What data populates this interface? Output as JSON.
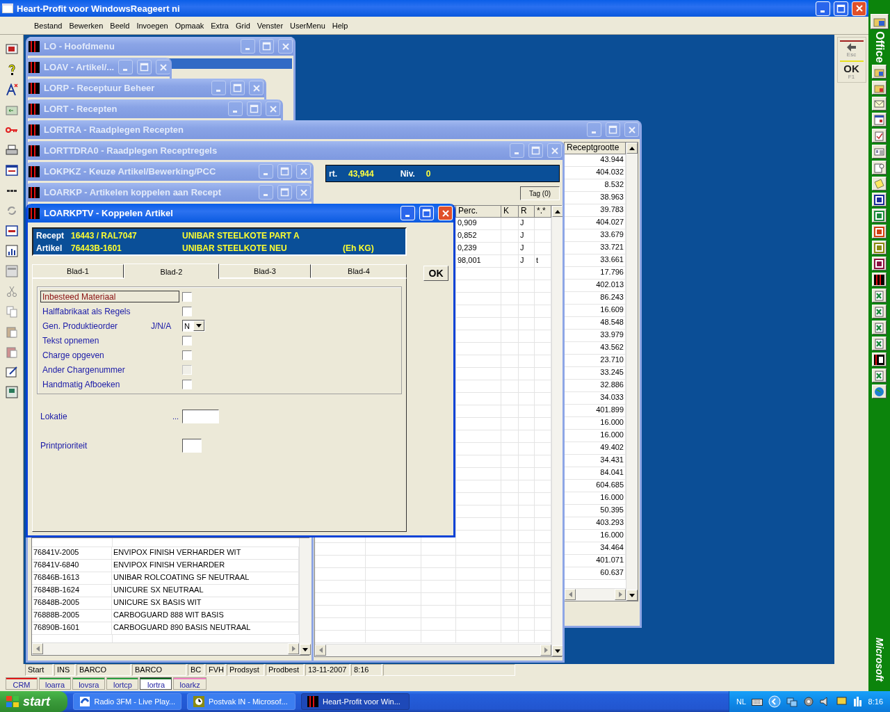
{
  "app": {
    "title": "Heart-Profit voor WindowsReageert ni"
  },
  "menu": [
    "Bestand",
    "Bewerken",
    "Beeld",
    "Invoegen",
    "Opmaak",
    "Extra",
    "Grid",
    "Venster",
    "UserMenu",
    "Help"
  ],
  "windows": [
    {
      "kind": "hoofdmenu",
      "title": "LO - Hoofdmenu",
      "active": false
    },
    {
      "kind": "plain",
      "title": "LOAV - Artikel/...",
      "active": false
    },
    {
      "kind": "plain",
      "title": "LORP - Receptuur Beheer",
      "active": false
    },
    {
      "kind": "plain",
      "title": "LORT - Recepten",
      "active": false
    },
    {
      "kind": "recepten",
      "title": "LORTRA - Raadplegen Recepten",
      "active": false
    },
    {
      "kind": "receptregels",
      "title": "LORTTDRA0 - Raadplegen Receptregels",
      "active": false
    },
    {
      "kind": "artikelen",
      "title": "LOKPKZ - Keuze Artikel/Bewerking/PCC",
      "active": false
    },
    {
      "kind": "plain",
      "title": "LOARKP - Artikelen koppelen aan Recept",
      "active": false
    },
    {
      "kind": "dialog",
      "title": "LOARKPTV - Koppelen Artikel",
      "active": true
    }
  ],
  "recepten": {
    "column": "Receptgrootte",
    "values": [
      "43.944",
      "404.032",
      "8.532",
      "38.963",
      "39.783",
      "404.027",
      "33.679",
      "33.721",
      "33.661",
      "17.796",
      "402.013",
      "86.243",
      "16.609",
      "48.548",
      "33.979",
      "43.562",
      "23.710",
      "33.245",
      "32.886",
      "34.033",
      "401.899",
      "16.000",
      "16.000",
      "49.402",
      "34.431",
      "84.041",
      "604.685",
      "16.000",
      "50.395",
      "403.293",
      "16.000",
      "34.464",
      "401.071",
      "60.637"
    ]
  },
  "receptregels": {
    "header": [
      {
        "label": "rt.",
        "value": "43,944"
      },
      {
        "label": "Niv.",
        "value": "0"
      }
    ],
    "tag_button": "Tag (0)",
    "columns": [
      "Perc.",
      "K",
      "R",
      "*.*"
    ],
    "rows": [
      {
        "perc": "0,909",
        "r": "J"
      },
      {
        "perc": "0,852",
        "r": "J"
      },
      {
        "perc": "0,239",
        "r": "J"
      },
      {
        "perc": "98,001",
        "r": "J",
        "flag": "t"
      }
    ]
  },
  "artikelen": {
    "rows": [
      {
        "code": "76841V-2005",
        "name": "ENVIPOX FINISH VERHARDER WIT"
      },
      {
        "code": "76841V-6840",
        "name": "ENVIPOX FINISH VERHARDER"
      },
      {
        "code": "76846B-1613",
        "name": "UNIBAR ROLCOATING SF NEUTRAAL"
      },
      {
        "code": "76848B-1624",
        "name": "UNICURE SX NEUTRAAL"
      },
      {
        "code": "76848B-2005",
        "name": "UNICURE SX BASIS WIT"
      },
      {
        "code": "76888B-2005",
        "name": "CARBOGUARD 888 WIT BASIS"
      },
      {
        "code": "76890B-1601",
        "name": "CARBOGUARD 890 BASIS NEUTRAAL"
      }
    ]
  },
  "dialog": {
    "info": [
      {
        "label": "Recept",
        "code": "16443 / RAL7047",
        "name": "UNIBAR STEELKOTE PART A"
      },
      {
        "label": "Artikel",
        "code": "76443B-1601",
        "name": "UNIBAR STEELKOTE NEU",
        "unit": "(Eh KG)"
      }
    ],
    "tabs": [
      {
        "label": "Blad-1",
        "selected": false
      },
      {
        "label": "Blad-2",
        "selected": true
      },
      {
        "label": "Blad-3",
        "selected": false
      },
      {
        "label": "Blad-4",
        "selected": false
      }
    ],
    "options": [
      {
        "kind": "checkbox",
        "label": "Inbesteed Materiaal",
        "checked": false,
        "focused": true,
        "disabled": false
      },
      {
        "kind": "checkbox",
        "label": "Halffabrikaat als Regels",
        "checked": false,
        "focused": false,
        "disabled": false
      },
      {
        "kind": "select",
        "label": "Gen. Produktieorder",
        "hint": "J/N/A",
        "value": "N",
        "focused": false
      },
      {
        "kind": "checkbox",
        "label": "Tekst opnemen",
        "checked": false,
        "focused": false,
        "disabled": false
      },
      {
        "kind": "checkbox",
        "label": "Charge opgeven",
        "checked": false,
        "focused": false,
        "disabled": false
      },
      {
        "kind": "checkbox",
        "label": "Ander Chargenummer",
        "checked": false,
        "focused": false,
        "disabled": true
      },
      {
        "kind": "checkbox",
        "label": "Handmatig Afboeken",
        "checked": false,
        "focused": false,
        "disabled": false
      }
    ],
    "fields": [
      {
        "kind": "lookup",
        "label": "Lokatie",
        "prefix": "..."
      },
      {
        "kind": "short",
        "label": "Printprioriteit"
      }
    ],
    "ok_button": "OK"
  },
  "side_buttons": [
    {
      "kind": "esc",
      "label": "Esc"
    },
    {
      "kind": "ok",
      "label": "OK",
      "key": "F1"
    }
  ],
  "status_bar": [
    "Start",
    "INS",
    "BARCO",
    "BARCO",
    "BC",
    "FVH",
    "Prodsyst",
    "Prodbest",
    "13-11-2007",
    "8:16"
  ],
  "window_tabs": [
    {
      "label": "CRM",
      "color": "#e01818",
      "selected": false
    },
    {
      "label": "loarra",
      "color": "#2aa040",
      "selected": false
    },
    {
      "label": "lovsra",
      "color": "#2aa040",
      "selected": false
    },
    {
      "label": "lortcp",
      "color": "#2aa040",
      "selected": false
    },
    {
      "label": "lortra",
      "color": "#0a6a20",
      "selected": true
    },
    {
      "label": "loarkz",
      "color": "#f080c0",
      "selected": false
    }
  ],
  "office_bar": {
    "title": "Office",
    "footer": "Microsoft"
  },
  "taskbar": {
    "start": "start",
    "tasks": [
      {
        "kind": "browser",
        "label": "Radio 3FM - Live Play...",
        "active": false
      },
      {
        "kind": "mail",
        "label": "Postvak IN - Microsof...",
        "active": false
      },
      {
        "kind": "app",
        "label": "Heart-Profit voor Win...",
        "active": true
      }
    ],
    "language": "NL",
    "clock": "8:16"
  }
}
